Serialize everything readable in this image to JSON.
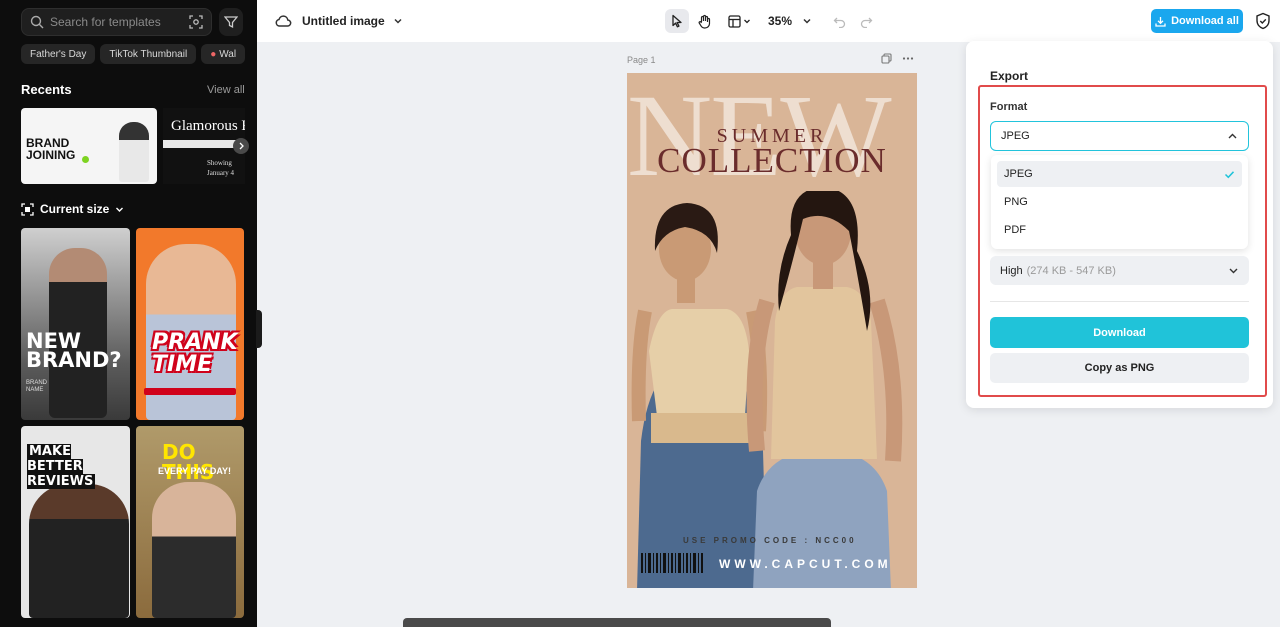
{
  "sidebar": {
    "search_placeholder": "Search for templates",
    "chips": [
      "Father's Day",
      "TikTok Thumbnail",
      "Wal"
    ],
    "recents_title": "Recents",
    "view_all": "View all",
    "recent_1": {
      "title": "BRAND JOINING"
    },
    "recent_2": {
      "title": "Glamorous E",
      "sub": "Showing January 4"
    },
    "size_label": "Current size",
    "templates": [
      {
        "title": "NEW BRAND?",
        "sub": "BRAND NAME"
      },
      {
        "title": "PRANK TIME"
      },
      {
        "title": "MAKE BETTER REVIEWS"
      },
      {
        "title": "DO THIS",
        "sub": "EVERY PAY DAY!"
      }
    ]
  },
  "topbar": {
    "doc_title": "Untitled image",
    "zoom": "35%",
    "download_all": "Download all"
  },
  "canvas": {
    "page_label": "Page 1",
    "poster": {
      "bg_word": "NEW",
      "line1": "SUMMER",
      "line2": "COLLECTION",
      "promo": "USE PROMO CODE : NCC00",
      "site": "WWW.CAPCUT.COM"
    }
  },
  "export": {
    "title": "Export",
    "format_label": "Format",
    "selected_format": "JPEG",
    "options": [
      "JPEG",
      "PNG",
      "PDF"
    ],
    "quality": "High",
    "quality_range": "(274 KB - 547 KB)",
    "download_label": "Download",
    "copy_label": "Copy as PNG"
  },
  "colors": {
    "accent": "#20c3d9",
    "download_all_bg": "#1aa7ee",
    "highlight_border": "#e14b4b",
    "poster_bg": "#d9b597"
  }
}
